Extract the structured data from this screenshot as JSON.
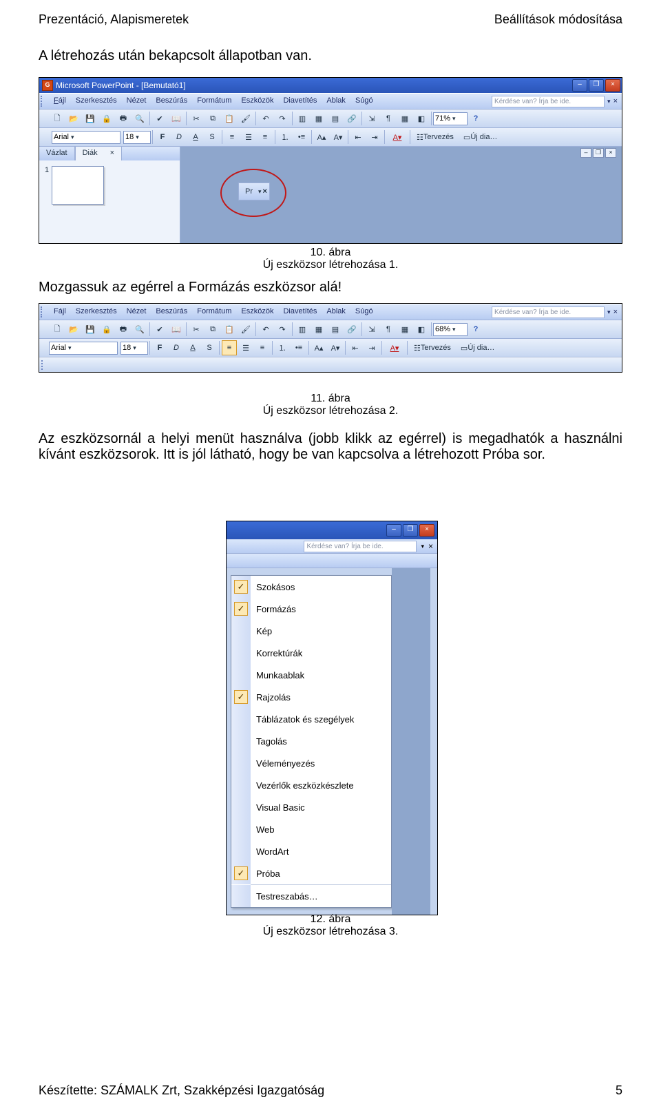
{
  "header": {
    "left": "Prezentáció, Alapismeretek",
    "right": "Beállítások módosítása"
  },
  "p1": "A létrehozás után bekapcsolt állapotban van.",
  "caption1a": "10. ábra",
  "caption1b": "Új eszközsor létrehozása 1.",
  "p2": "Mozgassuk az egérrel a Formázás eszközsor alá!",
  "caption2a": "11. ábra",
  "caption2b": "Új eszközsor létrehozása 2.",
  "p3": "Az eszközsornál a helyi menüt használva (jobb klikk az egérrel) is megadhatók a használni kívánt eszközsorok. Itt is jól látható, hogy be van kapcsolva a létrehozott Próba sor.",
  "caption3a": "12. ábra",
  "caption3b": "Új eszközsor létrehozása 3.",
  "footer": {
    "left": "Készítette: SZÁMALK Zrt, Szakképzési Igazgatóság",
    "right": "5"
  },
  "pp": {
    "title": "Microsoft PowerPoint - [Bemutató1]",
    "menu": [
      "Fájl",
      "Szerkesztés",
      "Nézet",
      "Beszúrás",
      "Formátum",
      "Eszközök",
      "Diavetítés",
      "Ablak",
      "Súgó"
    ],
    "ask": "Kérdése van? Írja be ide.",
    "zoom1": "71%",
    "zoom2": "68%",
    "font": "Arial",
    "fontsize": "18",
    "bold": "F",
    "italic": "D",
    "uline": "A",
    "shadow": "S",
    "tervez": "Tervezés",
    "newslide": "Új dia…",
    "tab_vazlat": "Vázlat",
    "tab_diak": "Diák",
    "slidenum": "1",
    "float_label": "Pr"
  },
  "ctx": {
    "items": [
      {
        "label": "Szokásos",
        "checked": true
      },
      {
        "label": "Formázás",
        "checked": true
      },
      {
        "label": "Kép",
        "checked": false
      },
      {
        "label": "Korrektúrák",
        "checked": false
      },
      {
        "label": "Munkaablak",
        "checked": false
      },
      {
        "label": "Rajzolás",
        "checked": true
      },
      {
        "label": "Táblázatok és szegélyek",
        "checked": false
      },
      {
        "label": "Tagolás",
        "checked": false
      },
      {
        "label": "Véleményezés",
        "checked": false
      },
      {
        "label": "Vezérlők eszközkészlete",
        "checked": false
      },
      {
        "label": "Visual Basic",
        "checked": false
      },
      {
        "label": "Web",
        "checked": false
      },
      {
        "label": "WordArt",
        "checked": false
      },
      {
        "label": "Próba",
        "checked": true
      }
    ],
    "customize": "Testreszabás…"
  }
}
